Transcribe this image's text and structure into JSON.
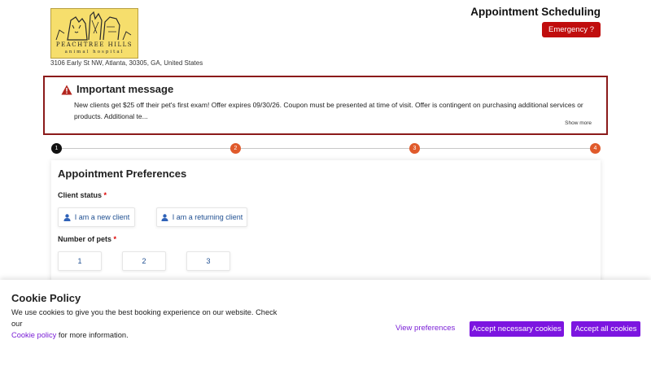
{
  "brand": {
    "logo_line1": "PEACHTREE HILLS",
    "logo_line2": "animal hospital",
    "address": "3106 Early St NW, Atlanta, 30305, GA, United States"
  },
  "header": {
    "title": "Appointment Scheduling",
    "emergency_label": "Emergency ?"
  },
  "message": {
    "icon": "warning-triangle-icon",
    "title": "Important message",
    "body": "New clients get $25 off their pet's first exam! Offer expires 09/30/26. Coupon must be presented at time of visit. Offer is contingent on purchasing additional services or products. Additional te...",
    "show_more": "Show more"
  },
  "stepper": {
    "steps": [
      "1",
      "2",
      "3",
      "4"
    ],
    "active_color": "#111111",
    "pending_color": "#e05a2b"
  },
  "preferences": {
    "title": "Appointment Preferences",
    "client_status_label": "Client status",
    "required_mark": "*",
    "client_options": [
      "I am a new client",
      "I am a returning client"
    ],
    "pets_label": "Number of pets",
    "pet_options": [
      "1",
      "2",
      "3"
    ]
  },
  "cookie": {
    "title": "Cookie Policy",
    "text_before": "We use cookies to give you the best booking experience on our website. Check our",
    "link_text": "Cookie policy",
    "text_after": "for more information.",
    "view_preferences": "View preferences",
    "accept_necessary": "Accept necessary cookies",
    "accept_all": "Accept all cookies"
  },
  "colors": {
    "emergency": "#c00d0d",
    "message_border": "#8b1a1a",
    "cookie_accent": "#7c15e0",
    "option_text": "#1f4f91"
  }
}
